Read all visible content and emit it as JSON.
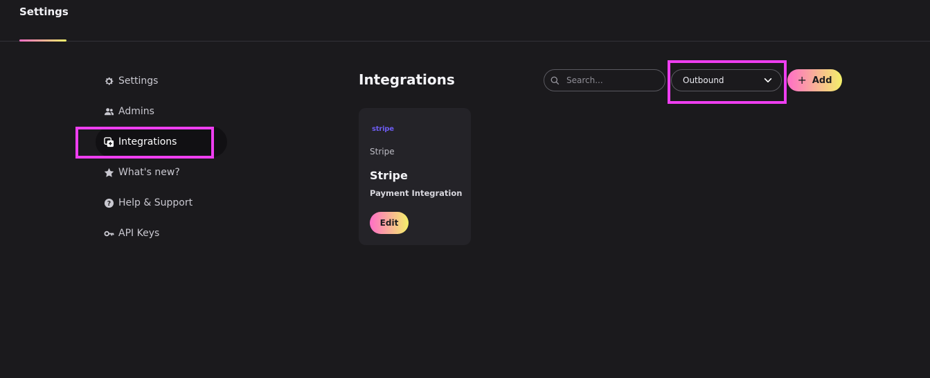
{
  "header": {
    "tab_label": "Settings"
  },
  "sidebar": {
    "items": [
      {
        "label": "Settings",
        "icon": "gear-icon"
      },
      {
        "label": "Admins",
        "icon": "users-icon"
      },
      {
        "label": "Integrations",
        "icon": "integrations-icon",
        "active": true
      },
      {
        "label": "What's new?",
        "icon": "star-icon"
      },
      {
        "label": "Help & Support",
        "icon": "help-icon"
      },
      {
        "label": "API Keys",
        "icon": "key-icon"
      }
    ]
  },
  "main": {
    "title": "Integrations",
    "search": {
      "placeholder": "Search..."
    },
    "direction_select": {
      "value": "Outbound"
    },
    "add_button": {
      "label": "Add"
    }
  },
  "cards": [
    {
      "logo_text": "stripe",
      "subtitle": "Stripe",
      "name": "Stripe",
      "description": "Payment Integration",
      "edit_label": "Edit"
    }
  ],
  "colors": {
    "background": "#1b1a1d",
    "card": "#242328",
    "highlight": "#ee3ef0",
    "gradient_start": "#ff6ec7",
    "gradient_end": "#f3f06a",
    "stripe_brand": "#6c5cf0"
  }
}
